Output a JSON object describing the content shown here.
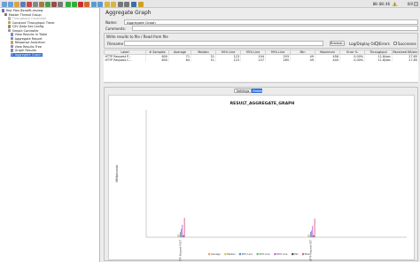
{
  "toolbar": {
    "icons": [
      {
        "name": "new-icon",
        "color": "#6aa0d8"
      },
      {
        "name": "templates-icon",
        "color": "#6aa0d8"
      },
      {
        "name": "open-icon",
        "color": "#d9a441"
      },
      {
        "name": "save-icon",
        "color": "#5b7fb5"
      },
      {
        "name": "cut-icon",
        "color": "#c44"
      },
      {
        "name": "copy-icon",
        "color": "#888"
      },
      {
        "name": "paste-icon",
        "color": "#a57c3c"
      },
      {
        "name": "expand-icon",
        "color": "#4a9a4a"
      },
      {
        "name": "collapse-icon",
        "color": "#9a4a4a"
      },
      {
        "name": "toggle-icon",
        "color": "#7a7a7a"
      },
      {
        "name": "start-icon",
        "color": "#2fae3a"
      },
      {
        "name": "start-no-pauses-icon",
        "color": "#2fae3a"
      },
      {
        "name": "stop-icon",
        "color": "#cc2d2d"
      },
      {
        "name": "shutdown-icon",
        "color": "#cc6a2d"
      },
      {
        "name": "remote-start-icon",
        "color": "#5a9ad0"
      },
      {
        "name": "remote-stop-icon",
        "color": "#5a9ad0"
      },
      {
        "name": "clear-icon",
        "color": "#d9b441"
      },
      {
        "name": "clear-all-icon",
        "color": "#d9b441"
      },
      {
        "name": "search-icon",
        "color": "#777"
      },
      {
        "name": "reset-search-icon",
        "color": "#777"
      },
      {
        "name": "function-helper-icon",
        "color": "#3c6ea8"
      },
      {
        "name": "help-icon",
        "color": "#d2a020"
      }
    ],
    "timer": "00:00:46",
    "active_threads": "0/0"
  },
  "tree": {
    "items": [
      {
        "label": "Test Plan Benefit-review",
        "icon": "test-plan-icon",
        "icon_color": "#7a6bb0"
      },
      {
        "label": "Master Thread Group",
        "icon": "thread-group-icon",
        "icon_color": "#777"
      },
      {
        "label": "Throughput Controller",
        "icon": "controller-icon",
        "icon_color": "#b5b5b5"
      },
      {
        "label": "Constant Throughput Timer",
        "icon": "timer-icon",
        "icon_color": "#c9a23b"
      },
      {
        "label": "CSV Data Set Config",
        "icon": "config-icon",
        "icon_color": "#8a8a8a"
      },
      {
        "label": "Simple Controller",
        "icon": "controller-icon",
        "icon_color": "#9a9a9a"
      },
      {
        "label": "View Results in Table",
        "icon": "listener-icon",
        "icon_color": "#7d8fc1"
      },
      {
        "label": "Aggregate Report",
        "icon": "listener-icon",
        "icon_color": "#7d8fc1"
      },
      {
        "label": "Response Assertion",
        "icon": "assertion-icon",
        "icon_color": "#c0a95a"
      },
      {
        "label": "View Results Tree",
        "icon": "listener-icon",
        "icon_color": "#7d8fc1"
      },
      {
        "label": "Graph Results",
        "icon": "listener-icon",
        "icon_color": "#7d8fc1"
      },
      {
        "label": "Aggregate Graph",
        "icon": "listener-icon",
        "icon_color": "#7d8fc1"
      }
    ]
  },
  "panel": {
    "title": "Aggregate Graph",
    "name_label": "Name:",
    "name_value": "Aggregate Graph",
    "comments_label": "Comments:",
    "write_results_label": "Write results to file / Read from file",
    "filename_label": "Filename",
    "browse_label": "Browse...",
    "log_display_label": "Log/Display Only:",
    "errors_label": "Errors",
    "successes_label": "Successes"
  },
  "table": {
    "columns": [
      "Label",
      "# Samples",
      "Average",
      "Median",
      "90% Line",
      "95% Line",
      "99% Line",
      "Min",
      "Maximum",
      "Error %",
      "Throughput",
      "Received KB/sec"
    ],
    "rows": [
      [
        "HTTP Request P...",
        "600",
        "71",
        "51",
        "123",
        "194",
        "293",
        "49",
        "456",
        "0.00%",
        "11.8/sec",
        "27.85"
      ],
      [
        "HTTP Request C...",
        "600",
        "64",
        "51",
        "123",
        "157",
        "265",
        "49",
        "440",
        "0.00%",
        "11.8/sec",
        "27.85"
      ],
      [
        "TOTAL",
        "1200",
        "68",
        "51",
        "123",
        "166",
        "293",
        "49",
        "456",
        "0.00%",
        "23.6/sec",
        "55.70"
      ]
    ]
  },
  "tabs": {
    "settings": "Settings",
    "graph": "Graph"
  },
  "chart_data": {
    "type": "bar",
    "title": "RESULT_AGGREGATE_GRAPH",
    "ylabel": "Milliseconds",
    "xlabel": "",
    "categories": [
      "HTTP Request POST",
      "HTTP Request GET"
    ],
    "series": [
      {
        "name": "Average",
        "color": "#e5a66a",
        "values": [
          71,
          64
        ]
      },
      {
        "name": "Median",
        "color": "#d7c44a",
        "values": [
          51,
          51
        ]
      },
      {
        "name": "90% Line",
        "color": "#5f8fd4",
        "values": [
          123,
          123
        ]
      },
      {
        "name": "95% Line",
        "color": "#5fbf6a",
        "values": [
          194,
          157
        ]
      },
      {
        "name": "99% Line",
        "color": "#c45fd4",
        "values": [
          293,
          265
        ]
      },
      {
        "name": "Min",
        "color": "#4a4a4a",
        "values": [
          49,
          49
        ]
      },
      {
        "name": "Max",
        "color": "#d45f8a",
        "values": [
          456,
          440
        ]
      }
    ],
    "legend_position": "bottom",
    "grid": false
  }
}
